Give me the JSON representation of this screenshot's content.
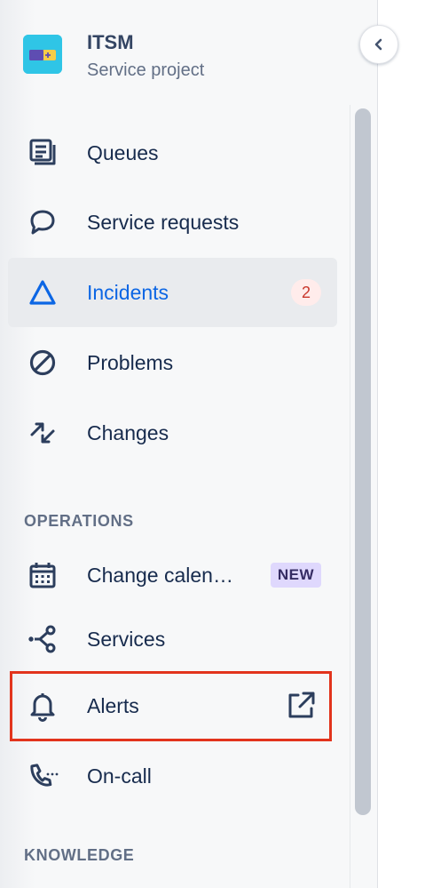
{
  "project": {
    "title": "ITSM",
    "subtitle": "Service project"
  },
  "nav": {
    "queues": {
      "label": "Queues",
      "icon": "queues-icon"
    },
    "service_requests": {
      "label": "Service requests",
      "icon": "speech-bubble-icon"
    },
    "incidents": {
      "label": "Incidents",
      "icon": "triangle-icon",
      "badge": "2",
      "selected": true
    },
    "problems": {
      "label": "Problems",
      "icon": "prohibited-icon"
    },
    "changes": {
      "label": "Changes",
      "icon": "changes-arrows-icon"
    }
  },
  "operations": {
    "heading": "OPERATIONS",
    "change_calendar": {
      "label": "Change calen…",
      "lozenge": "NEW",
      "icon": "calendar-icon"
    },
    "services": {
      "label": "Services",
      "icon": "services-graph-icon"
    },
    "alerts": {
      "label": "Alerts",
      "icon": "bell-icon",
      "trailing_icon": "external-link-icon"
    },
    "on_call": {
      "label": "On-call",
      "icon": "phone-icon"
    }
  },
  "knowledge": {
    "heading": "KNOWLEDGE"
  },
  "colors": {
    "selected_text": "#0c66e4",
    "badge_bg": "#ffeceb",
    "badge_text": "#c9372c",
    "lozenge_bg": "#dfd8fd",
    "highlight": "#e2341d"
  }
}
